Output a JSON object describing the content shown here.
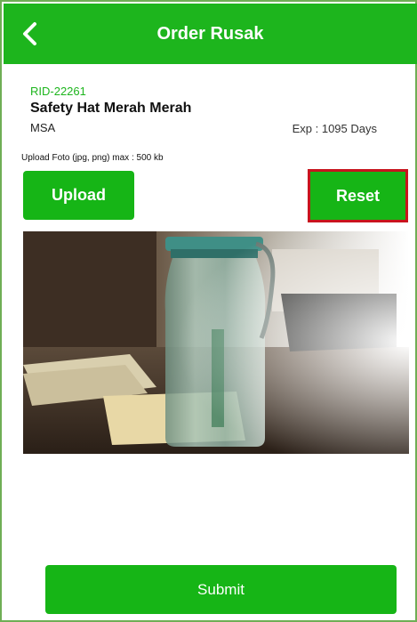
{
  "header": {
    "title": "Order Rusak",
    "back_icon": "chevron-left-icon",
    "color": "#1db51d"
  },
  "product": {
    "rid": "RID-22261",
    "name": "Safety Hat Merah Merah",
    "brand": "MSA",
    "exp": "Exp : 1095 Days"
  },
  "upload": {
    "hint": "Upload Foto (jpg, png) max : 500 kb",
    "upload_label": "Upload",
    "reset_label": "Reset",
    "photo_icon": "uploaded-photo"
  },
  "actions": {
    "submit_label": "Submit"
  },
  "colors": {
    "accent": "#16b516",
    "highlight": "#c8141e"
  }
}
